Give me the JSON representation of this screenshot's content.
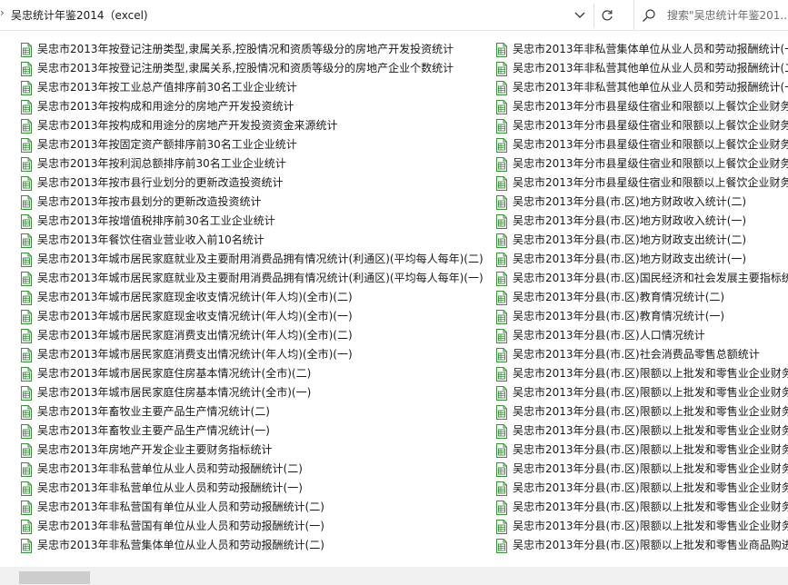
{
  "address": {
    "prefix": "›",
    "path": "吴忠统计年鉴2014（excel)",
    "dropdown_icon": "chevron-down-icon",
    "refresh_icon": "refresh-icon"
  },
  "search": {
    "placeholder": "搜索\"吴忠统计年鉴201...",
    "icon": "search-icon"
  },
  "file_icon_color": "#3a8f3a",
  "files_left": [
    "吴忠市2013年按登记注册类型,隶属关系,控股情况和资质等级分的房地产开发投资统计",
    "吴忠市2013年按登记注册类型,隶属关系,控股情况和资质等级分的房地产企业个数统计",
    "吴忠市2013年按工业总产值排序前30名工业企业统计",
    "吴忠市2013年按构成和用途分的房地产开发投资统计",
    "吴忠市2013年按构成和用途分的房地产开发投资资金来源统计",
    "吴忠市2013年按固定资产额排序前30名工业企业统计",
    "吴忠市2013年按利润总额排序前30名工业企业统计",
    "吴忠市2013年按市县行业划分的更新改造投资统计",
    "吴忠市2013年按市县划分的更新改造投资统计",
    "吴忠市2013年按增值税排序前30名工业企业统计",
    "吴忠市2013年餐饮住宿业营业收入前10名统计",
    "吴忠市2013年城市居民家庭就业及主要耐用消费品拥有情况统计(利通区)(平均每人每年)(二)",
    "吴忠市2013年城市居民家庭就业及主要耐用消费品拥有情况统计(利通区)(平均每人每年)(一)",
    "吴忠市2013年城市居民家庭现金收支情况统计(年人均)(全市)(二)",
    "吴忠市2013年城市居民家庭现金收支情况统计(年人均)(全市)(一)",
    "吴忠市2013年城市居民家庭消费支出情况统计(年人均)(全市)(二)",
    "吴忠市2013年城市居民家庭消费支出情况统计(年人均)(全市)(一)",
    "吴忠市2013年城市居民家庭住房基本情况统计(全市)(二)",
    "吴忠市2013年城市居民家庭住房基本情况统计(全市)(一)",
    "吴忠市2013年畜牧业主要产品生产情况统计(二)",
    "吴忠市2013年畜牧业主要产品生产情况统计(一)",
    "吴忠市2013年房地产开发企业主要财务指标统计",
    "吴忠市2013年非私营单位从业人员和劳动报酬统计(二)",
    "吴忠市2013年非私营单位从业人员和劳动报酬统计(一)",
    "吴忠市2013年非私营国有单位从业人员和劳动报酬统计(二)",
    "吴忠市2013年非私营国有单位从业人员和劳动报酬统计(一)",
    "吴忠市2013年非私营集体单位从业人员和劳动报酬统计(二)"
  ],
  "files_right": [
    "吴忠市2013年非私营集体单位从业人员和劳动报酬统计(一",
    "吴忠市2013年非私营其他单位从业人员和劳动报酬统计(二",
    "吴忠市2013年非私营其他单位从业人员和劳动报酬统计(一",
    "吴忠市2013年分市县星级住宿业和限额以上餐饮企业财务",
    "吴忠市2013年分市县星级住宿业和限额以上餐饮企业财务",
    "吴忠市2013年分市县星级住宿业和限额以上餐饮企业财务",
    "吴忠市2013年分市县星级住宿业和限额以上餐饮企业财务",
    "吴忠市2013年分市县星级住宿业和限额以上餐饮企业财务",
    "吴忠市2013年分县(市.区)地方财政收入统计(二)",
    "吴忠市2013年分县(市.区)地方财政收入统计(一)",
    "吴忠市2013年分县(市.区)地方财政支出统计(二)",
    "吴忠市2013年分县(市.区)地方财政支出统计(一)",
    "吴忠市2013年分县(市.区)国民经济和社会发展主要指标统",
    "吴忠市2013年分县(市.区)教育情况统计(二)",
    "吴忠市2013年分县(市.区)教育情况统计(一)",
    "吴忠市2013年分县(市.区)人口情况统计",
    "吴忠市2013年分县(市.区)社会消费品零售总额统计",
    "吴忠市2013年分县(市.区)限额以上批发和零售业企业财务",
    "吴忠市2013年分县(市.区)限额以上批发和零售业企业财务",
    "吴忠市2013年分县(市.区)限额以上批发和零售业企业财务",
    "吴忠市2013年分县(市.区)限额以上批发和零售业企业财务",
    "吴忠市2013年分县(市.区)限额以上批发和零售业企业财务",
    "吴忠市2013年分县(市.区)限额以上批发和零售业企业财务",
    "吴忠市2013年分县(市.区)限额以上批发和零售业企业财务",
    "吴忠市2013年分县(市.区)限额以上批发和零售业企业财务",
    "吴忠市2013年分县(市.区)限额以上批发和零售业企业财务",
    "吴忠市2013年分县(市.区)限额以上批发和零售业商品购进"
  ]
}
